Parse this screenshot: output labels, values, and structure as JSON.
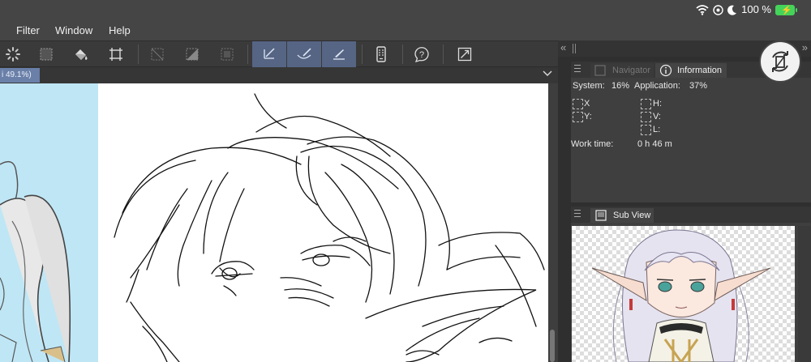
{
  "status": {
    "wifi_icon": "wifi-icon",
    "location_icon": "location-icon",
    "moon_icon": "moon-icon",
    "battery_text": "100 %",
    "battery_color": "#45d45a"
  },
  "menu": {
    "items": [
      "Filter",
      "Window",
      "Help"
    ]
  },
  "toolbar": {
    "active_color": "#566584",
    "tools": [
      "spinner-icon",
      "selection-icon",
      "fill-icon",
      "transform-icon",
      "deselect-icon",
      "invert-icon",
      "crop-icon",
      "pen-stroke-icon",
      "brush-stroke-icon",
      "fine-brush-icon",
      "device-icon",
      "help-icon",
      "resize-icon"
    ]
  },
  "canvas": {
    "tab_label": "i 49.1%)"
  },
  "info_panel": {
    "tab_navigator": "Navigator",
    "tab_information": "Information",
    "system_label": "System:",
    "system_value": "16%",
    "application_label": "Application:",
    "application_value": "37%",
    "x_label": "X",
    "y_label": "Y:",
    "h_label": "H:",
    "v_label": "V:",
    "l_label": "L:",
    "work_time_label": "Work time:",
    "work_time_value": "0 h 46 m"
  },
  "subview": {
    "tab_label": "Sub View"
  }
}
